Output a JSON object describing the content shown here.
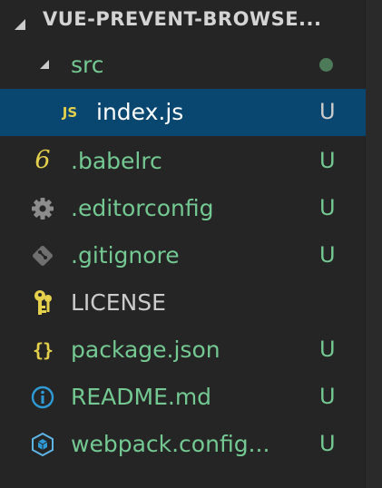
{
  "explorer": {
    "title": "VUE-PREVENT-BROWSE...",
    "icons": {
      "header_twisty": "chevron-down-expanded-icon",
      "folder_twisty": "chevron-down-expanded-icon",
      "modified_dot": "dot-indicator-icon"
    },
    "folder": {
      "label": "src",
      "children": [
        {
          "label": "index.js",
          "icon": "javascript-file-icon",
          "icon_text": "JS",
          "status": "U",
          "selected": true
        }
      ]
    },
    "files": [
      {
        "label": ".babelrc",
        "icon": "babel-file-icon",
        "icon_text": "6",
        "status": "U"
      },
      {
        "label": ".editorconfig",
        "icon": "gear-icon",
        "status": "U"
      },
      {
        "label": ".gitignore",
        "icon": "git-icon",
        "status": "U"
      },
      {
        "label": "LICENSE",
        "icon": "license-key-icon",
        "status": ""
      },
      {
        "label": "package.json",
        "icon": "json-file-icon",
        "icon_text": "{}",
        "status": "U"
      },
      {
        "label": "README.md",
        "icon": "info-icon",
        "status": "U"
      },
      {
        "label": "webpack.config...",
        "icon": "webpack-cube-icon",
        "status": "U"
      }
    ]
  },
  "colors": {
    "background": "#252526",
    "selection": "#094771",
    "untracked_text": "#73c991",
    "plain_text": "#cccccc",
    "icon_yellow": "#e5d04b",
    "icon_gray": "#8c8c8c",
    "icon_blue": "#2f9bd6",
    "dot": "#4d7a59"
  }
}
